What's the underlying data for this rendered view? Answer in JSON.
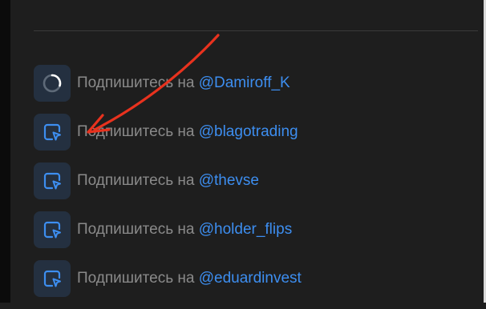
{
  "colors": {
    "panel_bg": "#1e1e1e",
    "icon_bg": "#243040",
    "prefix_text": "#8a8a8a",
    "link_text": "#3d8ef0",
    "annotation_arrow": "#e8321e"
  },
  "tasks": [
    {
      "icon": "loading-ring-icon",
      "prefix": "Подпишитесь на",
      "handle": "@Damiroff_K"
    },
    {
      "icon": "tap-target-icon",
      "prefix": "Подпишитесь на",
      "handle": "@blagotrading"
    },
    {
      "icon": "tap-target-icon",
      "prefix": "Подпишитесь на",
      "handle": "@thevse"
    },
    {
      "icon": "tap-target-icon",
      "prefix": "Подпишитесь на",
      "handle": "@holder_flips"
    },
    {
      "icon": "tap-target-icon",
      "prefix": "Подпишитесь на",
      "handle": "@eduardinvest"
    }
  ]
}
